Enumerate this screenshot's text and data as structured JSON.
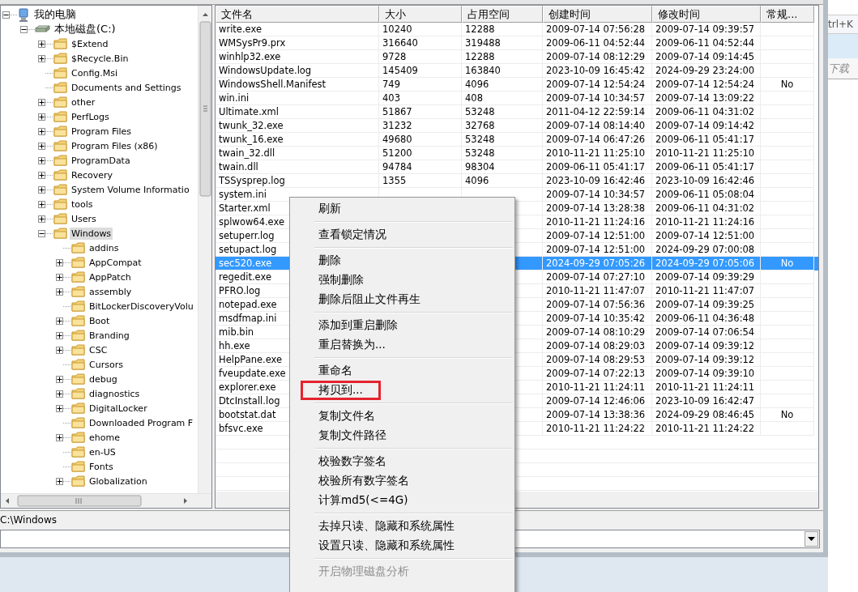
{
  "tree": {
    "label": "我的电脑",
    "kind": "computer",
    "expandable": true,
    "expanded": true,
    "selected": false,
    "children": [
      {
        "label": "本地磁盘(C:)",
        "kind": "drive",
        "expandable": true,
        "expanded": true,
        "selected": false,
        "children": [
          {
            "label": "$Extend",
            "kind": "folder",
            "expandable": true,
            "expanded": false,
            "selected": false
          },
          {
            "label": "$Recycle.Bin",
            "kind": "folder",
            "expandable": true,
            "expanded": false,
            "selected": false
          },
          {
            "label": "Config.Msi",
            "kind": "folder",
            "expandable": false,
            "selected": false
          },
          {
            "label": "Documents and Settings",
            "kind": "folder",
            "expandable": false,
            "selected": false
          },
          {
            "label": "other",
            "kind": "folder",
            "expandable": true,
            "expanded": false,
            "selected": false
          },
          {
            "label": "PerfLogs",
            "kind": "folder",
            "expandable": true,
            "expanded": false,
            "selected": false
          },
          {
            "label": "Program Files",
            "kind": "folder",
            "expandable": true,
            "expanded": false,
            "selected": false
          },
          {
            "label": "Program Files (x86)",
            "kind": "folder",
            "expandable": true,
            "expanded": false,
            "selected": false
          },
          {
            "label": "ProgramData",
            "kind": "folder",
            "expandable": true,
            "expanded": false,
            "selected": false
          },
          {
            "label": "Recovery",
            "kind": "folder",
            "expandable": true,
            "expanded": false,
            "selected": false
          },
          {
            "label": "System Volume Informatio",
            "kind": "folder",
            "expandable": true,
            "expanded": false,
            "selected": false
          },
          {
            "label": "tools",
            "kind": "folder",
            "expandable": true,
            "expanded": false,
            "selected": false
          },
          {
            "label": "Users",
            "kind": "folder",
            "expandable": true,
            "expanded": false,
            "selected": false
          },
          {
            "label": "Windows",
            "kind": "folder",
            "expandable": true,
            "expanded": true,
            "selected": true,
            "children": [
              {
                "label": "addins",
                "kind": "folder",
                "expandable": false,
                "selected": false
              },
              {
                "label": "AppCompat",
                "kind": "folder",
                "expandable": true,
                "expanded": false,
                "selected": false
              },
              {
                "label": "AppPatch",
                "kind": "folder",
                "expandable": true,
                "expanded": false,
                "selected": false
              },
              {
                "label": "assembly",
                "kind": "folder",
                "expandable": true,
                "expanded": false,
                "selected": false
              },
              {
                "label": "BitLockerDiscoveryVolu",
                "kind": "folder",
                "expandable": false,
                "selected": false
              },
              {
                "label": "Boot",
                "kind": "folder",
                "expandable": true,
                "expanded": false,
                "selected": false
              },
              {
                "label": "Branding",
                "kind": "folder",
                "expandable": true,
                "expanded": false,
                "selected": false
              },
              {
                "label": "CSC",
                "kind": "folder",
                "expandable": true,
                "expanded": false,
                "selected": false
              },
              {
                "label": "Cursors",
                "kind": "folder",
                "expandable": false,
                "selected": false
              },
              {
                "label": "debug",
                "kind": "folder",
                "expandable": true,
                "expanded": false,
                "selected": false
              },
              {
                "label": "diagnostics",
                "kind": "folder",
                "expandable": true,
                "expanded": false,
                "selected": false
              },
              {
                "label": "DigitalLocker",
                "kind": "folder",
                "expandable": true,
                "expanded": false,
                "selected": false
              },
              {
                "label": "Downloaded Program F",
                "kind": "folder",
                "expandable": false,
                "selected": false
              },
              {
                "label": "ehome",
                "kind": "folder",
                "expandable": true,
                "expanded": false,
                "selected": false
              },
              {
                "label": "en-US",
                "kind": "folder",
                "expandable": false,
                "selected": false
              },
              {
                "label": "Fonts",
                "kind": "folder",
                "expandable": false,
                "selected": false
              },
              {
                "label": "Globalization",
                "kind": "folder",
                "expandable": true,
                "expanded": false,
                "selected": false
              }
            ]
          }
        ]
      }
    ]
  },
  "table": {
    "columns": [
      "文件名",
      "大小",
      "占用空间",
      "创建时间",
      "修改时间",
      "常规..."
    ],
    "rows": [
      {
        "name": "write.exe",
        "size": "10240",
        "allocated": "12288",
        "created": "2009-07-14 07:56:28",
        "modified": "2009-07-14 09:39:57",
        "selected": false
      },
      {
        "name": "WMSysPr9.prx",
        "size": "316640",
        "allocated": "319488",
        "created": "2009-06-11 04:52:44",
        "modified": "2009-06-11 04:52:44",
        "selected": false
      },
      {
        "name": "winhlp32.exe",
        "size": "9728",
        "allocated": "12288",
        "created": "2009-07-14 08:12:29",
        "modified": "2009-07-14 09:14:45",
        "selected": false
      },
      {
        "name": "WindowsUpdate.log",
        "size": "145409",
        "allocated": "163840",
        "created": "2023-10-09 16:45:42",
        "modified": "2024-09-29 23:24:00",
        "selected": false
      },
      {
        "name": "WindowsShell.Manifest",
        "size": "749",
        "allocated": "4096",
        "created": "2009-07-14 12:54:24",
        "modified": "2009-07-14 12:54:24",
        "normal": "No",
        "selected": false
      },
      {
        "name": "win.ini",
        "size": "403",
        "allocated": "408",
        "created": "2009-07-14 10:34:57",
        "modified": "2009-07-14 13:09:22",
        "selected": false
      },
      {
        "name": "Ultimate.xml",
        "size": "51867",
        "allocated": "53248",
        "created": "2011-04-12 22:59:14",
        "modified": "2009-06-11 04:31:02",
        "selected": false
      },
      {
        "name": "twunk_32.exe",
        "size": "31232",
        "allocated": "32768",
        "created": "2009-07-14 08:14:40",
        "modified": "2009-07-14 09:14:42",
        "selected": false
      },
      {
        "name": "twunk_16.exe",
        "size": "49680",
        "allocated": "53248",
        "created": "2009-07-14 06:47:26",
        "modified": "2009-06-11 05:41:17",
        "selected": false
      },
      {
        "name": "twain_32.dll",
        "size": "51200",
        "allocated": "53248",
        "created": "2010-11-21 11:25:10",
        "modified": "2010-11-21 11:25:10",
        "selected": false
      },
      {
        "name": "twain.dll",
        "size": "94784",
        "allocated": "98304",
        "created": "2009-06-11 05:41:17",
        "modified": "2009-06-11 05:41:17",
        "selected": false
      },
      {
        "name": "TSSysprep.log",
        "size": "1355",
        "allocated": "4096",
        "created": "2023-10-09 16:42:46",
        "modified": "2023-10-09 16:42:46",
        "selected": false
      },
      {
        "name": "system.ini",
        "created": "2009-07-14 10:34:57",
        "modified": "2009-06-11 05:08:04",
        "selected": false
      },
      {
        "name": "Starter.xml",
        "created": "2009-07-14 13:28:38",
        "modified": "2009-06-11 04:31:02",
        "selected": false
      },
      {
        "name": "splwow64.exe",
        "created": "2010-11-21 11:24:16",
        "modified": "2010-11-21 11:24:16",
        "selected": false
      },
      {
        "name": "setuperr.log",
        "created": "2009-07-14 12:51:00",
        "modified": "2009-07-14 12:51:00",
        "selected": false
      },
      {
        "name": "setupact.log",
        "created": "2009-07-14 12:51:00",
        "modified": "2024-09-29 07:00:08",
        "selected": false
      },
      {
        "name": "sec520.exe",
        "created": "2024-09-29 07:05:26",
        "modified": "2024-09-29 07:05:06",
        "normal": "No",
        "selected": true
      },
      {
        "name": "regedit.exe",
        "created": "2009-07-14 07:27:10",
        "modified": "2009-07-14 09:39:29",
        "selected": false
      },
      {
        "name": "PFRO.log",
        "created": "2010-11-21 11:47:07",
        "modified": "2010-11-21 11:47:07",
        "selected": false
      },
      {
        "name": "notepad.exe",
        "created": "2009-07-14 07:56:36",
        "modified": "2009-07-14 09:39:25",
        "selected": false
      },
      {
        "name": "msdfmap.ini",
        "created": "2009-07-14 10:35:42",
        "modified": "2009-06-11 04:36:48",
        "selected": false
      },
      {
        "name": "mib.bin",
        "created": "2009-07-14 08:10:29",
        "modified": "2009-07-14 07:06:54",
        "selected": false
      },
      {
        "name": "hh.exe",
        "created": "2009-07-14 08:29:03",
        "modified": "2009-07-14 09:39:12",
        "selected": false
      },
      {
        "name": "HelpPane.exe",
        "created": "2009-07-14 08:29:53",
        "modified": "2009-07-14 09:39:12",
        "selected": false
      },
      {
        "name": "fveupdate.exe",
        "created": "2009-07-14 07:22:13",
        "modified": "2009-07-14 09:39:10",
        "selected": false
      },
      {
        "name": "explorer.exe",
        "created": "2010-11-21 11:24:11",
        "modified": "2010-11-21 11:24:11",
        "selected": false
      },
      {
        "name": "DtcInstall.log",
        "created": "2009-07-14 12:46:06",
        "modified": "2023-10-09 16:42:47",
        "selected": false
      },
      {
        "name": "bootstat.dat",
        "created": "2009-07-14 13:38:36",
        "modified": "2024-09-29 08:46:45",
        "normal": "No",
        "selected": false
      },
      {
        "name": "bfsvc.exe",
        "created": "2010-11-21 11:24:22",
        "modified": "2010-11-21 11:24:22",
        "selected": false
      }
    ]
  },
  "path_bar": {
    "text": "C:\\Windows"
  },
  "context_menu": {
    "groups": [
      [
        {
          "label": "刷新",
          "disabled": false,
          "highlighted": false
        }
      ],
      [
        {
          "label": "查看锁定情况",
          "disabled": false,
          "highlighted": false
        }
      ],
      [
        {
          "label": "删除",
          "disabled": false,
          "highlighted": false
        },
        {
          "label": "强制删除",
          "disabled": false,
          "highlighted": false
        },
        {
          "label": "删除后阻止文件再生",
          "disabled": false,
          "highlighted": false
        }
      ],
      [
        {
          "label": "添加到重启删除",
          "disabled": false,
          "highlighted": false
        },
        {
          "label": "重启替换为...",
          "disabled": false,
          "highlighted": false
        }
      ],
      [
        {
          "label": "重命名",
          "disabled": false,
          "highlighted": false
        },
        {
          "label": "拷贝到...",
          "disabled": false,
          "highlighted": true
        }
      ],
      [
        {
          "label": "复制文件名",
          "disabled": false,
          "highlighted": false
        },
        {
          "label": "复制文件路径",
          "disabled": false,
          "highlighted": false
        }
      ],
      [
        {
          "label": "校验数字签名",
          "disabled": false,
          "highlighted": false
        },
        {
          "label": "校验所有数字签名",
          "disabled": false,
          "highlighted": false
        },
        {
          "label": "计算md5(<=4G)",
          "disabled": false,
          "highlighted": false
        }
      ],
      [
        {
          "label": "去掉只读、隐藏和系统属性",
          "disabled": false,
          "highlighted": false
        },
        {
          "label": "设置只读、隐藏和系统属性",
          "disabled": false,
          "highlighted": false
        }
      ],
      [
        {
          "label": "开启物理磁盘分析",
          "disabled": true,
          "highlighted": false
        }
      ]
    ]
  },
  "background_window": {
    "shortcut": "trl+K",
    "search": {
      "placeholder": "下载"
    }
  }
}
